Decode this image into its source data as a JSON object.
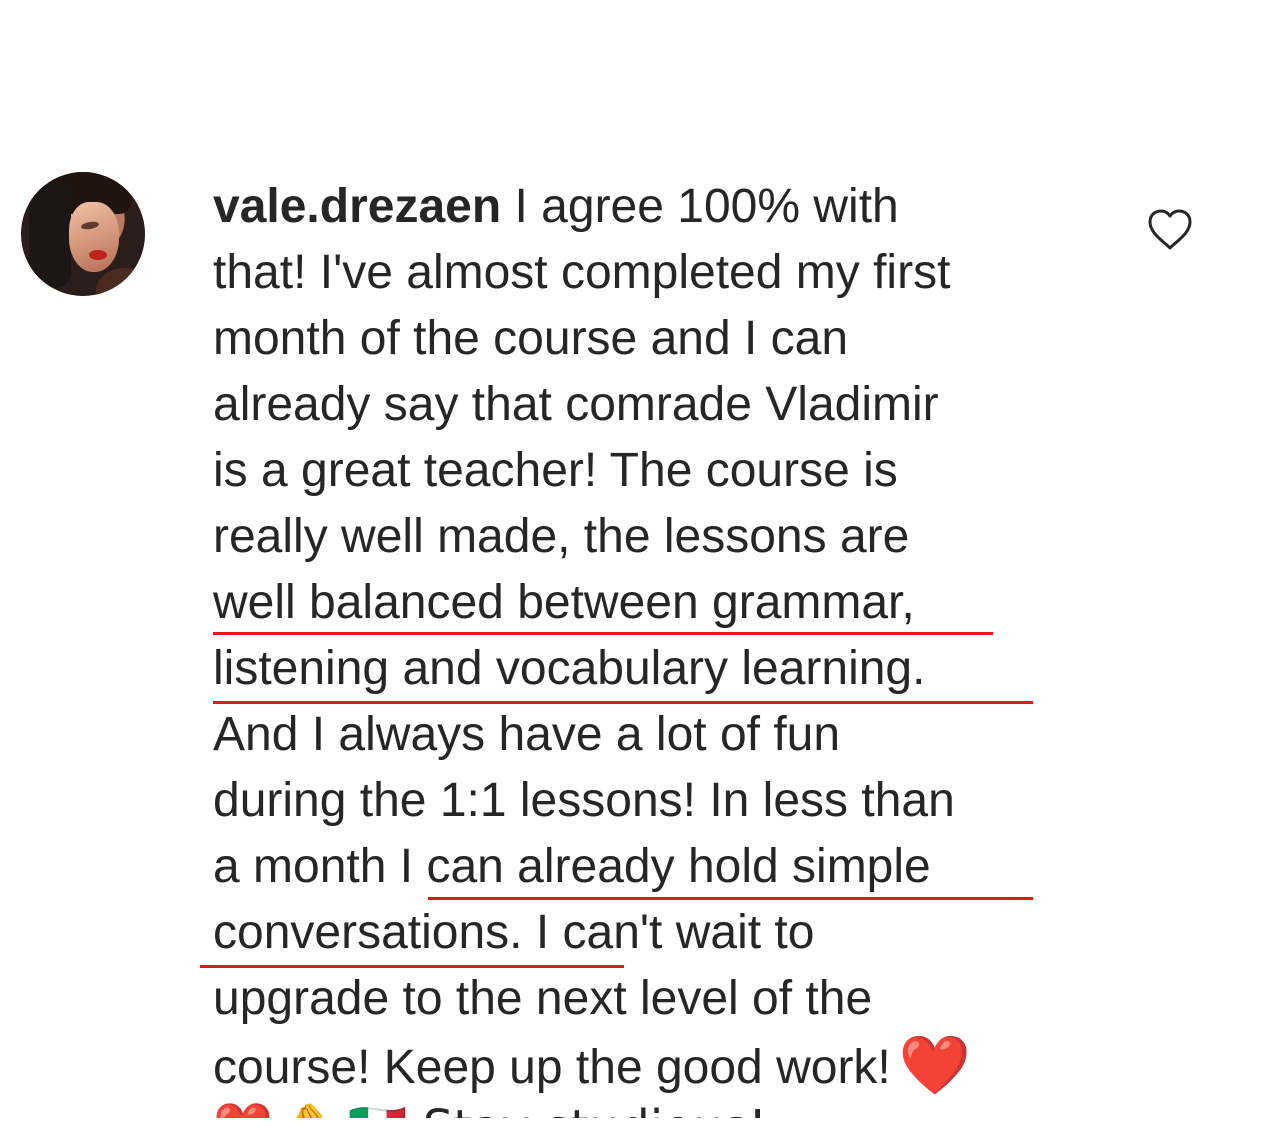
{
  "comment": {
    "username": "vale.drezaen",
    "text_lines": [
      " I agree 100% with",
      "that! I've almost completed my first",
      "month of the course and I can",
      "already say that comrade Vladimir",
      "is a great teacher! The course is",
      "really well made, the lessons are",
      "well balanced between grammar,",
      "listening and vocabulary learning.",
      "And I always have a lot of fun",
      "during the 1:1 lessons! In less than",
      "a month I can already hold simple",
      "conversations. I can't wait to",
      "upgrade to the next level of the",
      "course! Keep up the good work!"
    ],
    "heart_emoji": "❤️",
    "partial_line": "❤️🤌 🇮🇹 Stay studious!"
  },
  "icons": {
    "like": "heart-outline-icon"
  },
  "colors": {
    "text": "#262626",
    "underline": "#e01818",
    "heart": "#e0191f"
  }
}
